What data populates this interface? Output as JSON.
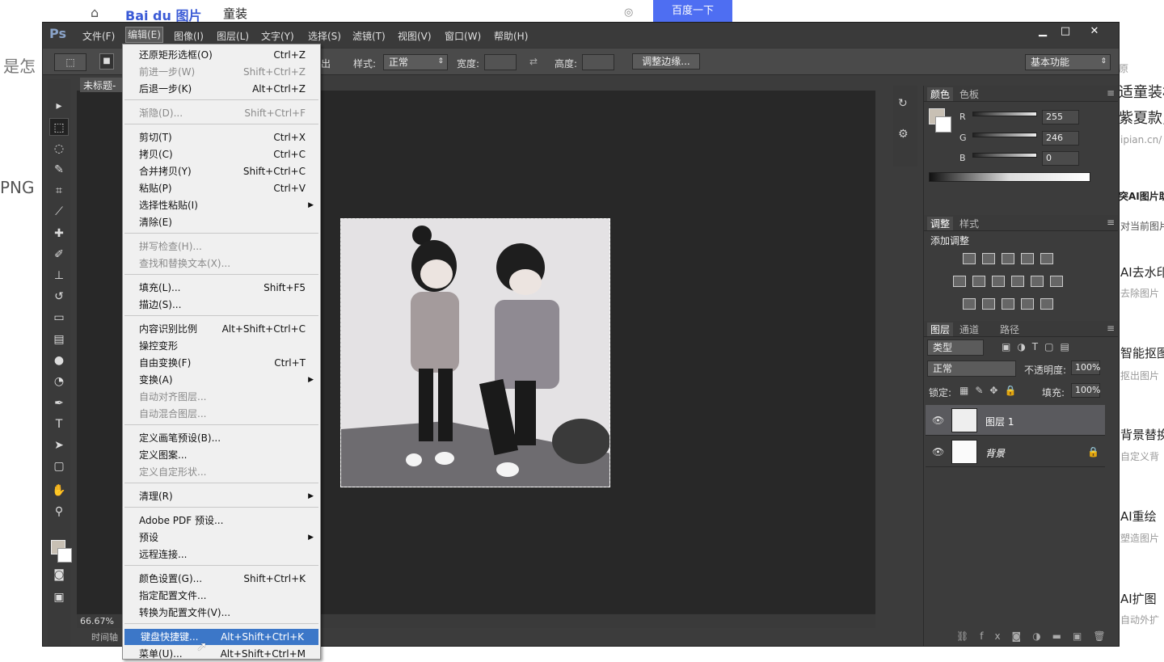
{
  "browser_bg": {
    "search_query": "童装",
    "search_button": "百度一下",
    "logo": "Bai du 图片",
    "left_texts": [
      "是怎",
      "PNG"
    ],
    "right_texts": [
      "原",
      "适童装林",
      "紫夏款,",
      "ipian.cn/",
      "突AI图片助",
      "对当前图片",
      "AI去水印",
      "去除图片",
      "智能抠图",
      "抠出图片",
      "背景替换",
      "自定义背",
      "AI重绘",
      "塑造图片",
      "AI扩图",
      "自动外扩"
    ]
  },
  "ps": {
    "logo": "Ps",
    "menubar": [
      "文件(F)",
      "编辑(E)",
      "图像(I)",
      "图层(L)",
      "文字(Y)",
      "选择(S)",
      "滤镜(T)",
      "视图(V)",
      "窗口(W)",
      "帮助(H)"
    ],
    "window_buttons": [
      "▁",
      "□",
      "✕"
    ],
    "options": {
      "style_label": "样式:",
      "style_value": "正常",
      "width_label": "宽度:",
      "height_label": "高度:",
      "refine_button": "调整边缘...",
      "workspace": "基本功能",
      "partial_label": "出"
    },
    "doc_tab": "未标题-",
    "zoom": "66.67%",
    "bottom_tab": "时间轴"
  },
  "edit_menu": {
    "items": [
      {
        "label": "还原矩形选框(O)",
        "shortcut": "Ctrl+Z",
        "disabled": false
      },
      {
        "label": "前进一步(W)",
        "shortcut": "Shift+Ctrl+Z",
        "disabled": true
      },
      {
        "label": "后退一步(K)",
        "shortcut": "Alt+Ctrl+Z",
        "disabled": false
      },
      {
        "label": "渐隐(D)...",
        "shortcut": "Shift+Ctrl+F",
        "disabled": true
      },
      {
        "label": "剪切(T)",
        "shortcut": "Ctrl+X",
        "disabled": false
      },
      {
        "label": "拷贝(C)",
        "shortcut": "Ctrl+C",
        "disabled": false
      },
      {
        "label": "合并拷贝(Y)",
        "shortcut": "Shift+Ctrl+C",
        "disabled": false
      },
      {
        "label": "粘贴(P)",
        "shortcut": "Ctrl+V",
        "disabled": false
      },
      {
        "label": "选择性粘贴(I)",
        "shortcut": "",
        "disabled": false,
        "submenu": true
      },
      {
        "label": "清除(E)",
        "shortcut": "",
        "disabled": false
      },
      {
        "label": "拼写检查(H)...",
        "shortcut": "",
        "disabled": true
      },
      {
        "label": "查找和替换文本(X)...",
        "shortcut": "",
        "disabled": true
      },
      {
        "label": "填充(L)...",
        "shortcut": "Shift+F5",
        "disabled": false
      },
      {
        "label": "描边(S)...",
        "shortcut": "",
        "disabled": false
      },
      {
        "label": "内容识别比例",
        "shortcut": "Alt+Shift+Ctrl+C",
        "disabled": false
      },
      {
        "label": "操控变形",
        "shortcut": "",
        "disabled": false
      },
      {
        "label": "自由变换(F)",
        "shortcut": "Ctrl+T",
        "disabled": false
      },
      {
        "label": "变换(A)",
        "shortcut": "",
        "disabled": false,
        "submenu": true
      },
      {
        "label": "自动对齐图层...",
        "shortcut": "",
        "disabled": true
      },
      {
        "label": "自动混合图层...",
        "shortcut": "",
        "disabled": true
      },
      {
        "label": "定义画笔预设(B)...",
        "shortcut": "",
        "disabled": false
      },
      {
        "label": "定义图案...",
        "shortcut": "",
        "disabled": false
      },
      {
        "label": "定义自定形状...",
        "shortcut": "",
        "disabled": true
      },
      {
        "label": "清理(R)",
        "shortcut": "",
        "disabled": false,
        "submenu": true
      },
      {
        "label": "Adobe PDF 预设...",
        "shortcut": "",
        "disabled": false
      },
      {
        "label": "预设",
        "shortcut": "",
        "disabled": false,
        "submenu": true
      },
      {
        "label": "远程连接...",
        "shortcut": "",
        "disabled": false
      },
      {
        "label": "颜色设置(G)...",
        "shortcut": "Shift+Ctrl+K",
        "disabled": false
      },
      {
        "label": "指定配置文件...",
        "shortcut": "",
        "disabled": false
      },
      {
        "label": "转换为配置文件(V)...",
        "shortcut": "",
        "disabled": false
      },
      {
        "label": "键盘快捷键...",
        "shortcut": "Alt+Shift+Ctrl+K",
        "disabled": false,
        "highlighted": true
      },
      {
        "label": "菜单(U)...",
        "shortcut": "Alt+Shift+Ctrl+M",
        "disabled": false
      }
    ]
  },
  "color_panel": {
    "tabs": [
      "颜色",
      "色板"
    ],
    "r_label": "R",
    "r": "255",
    "g_label": "G",
    "g": "246",
    "b_label": "B",
    "b": "0"
  },
  "adjust_panel": {
    "tabs": [
      "调整",
      "样式"
    ],
    "title": "添加调整"
  },
  "layers_panel": {
    "tabs": [
      "图层",
      "通道",
      "路径"
    ],
    "filter": "类型",
    "blend_mode": "正常",
    "opacity_label": "不透明度:",
    "opacity": "100%",
    "lock_label": "锁定:",
    "fill_label": "填充:",
    "fill": "100%",
    "layers": [
      {
        "name": "图层 1",
        "selected": true
      },
      {
        "name": "背景",
        "locked": true
      }
    ]
  }
}
